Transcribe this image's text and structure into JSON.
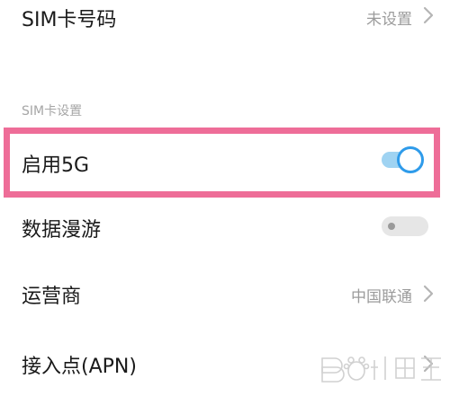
{
  "rows": {
    "sim_number": {
      "label": "SIM卡号码",
      "value": "未设置"
    },
    "enable_5g": {
      "label": "启用5G",
      "enabled": true
    },
    "data_roaming": {
      "label": "数据漫游",
      "enabled": false
    },
    "carrier": {
      "label": "运营商",
      "value": "中国联通"
    },
    "apn": {
      "label": "接入点(APN)"
    }
  },
  "section": {
    "header": "SIM卡设置"
  },
  "colors": {
    "highlight": "#ee6d98",
    "toggle_accent": "#2e9bea",
    "toggle_track_on": "#9fd3f2",
    "secondary_text": "#9b9b9b"
  },
  "icons": {
    "chevron": "chevron-right-icon",
    "watermark": "baidu-jingyan-watermark"
  }
}
